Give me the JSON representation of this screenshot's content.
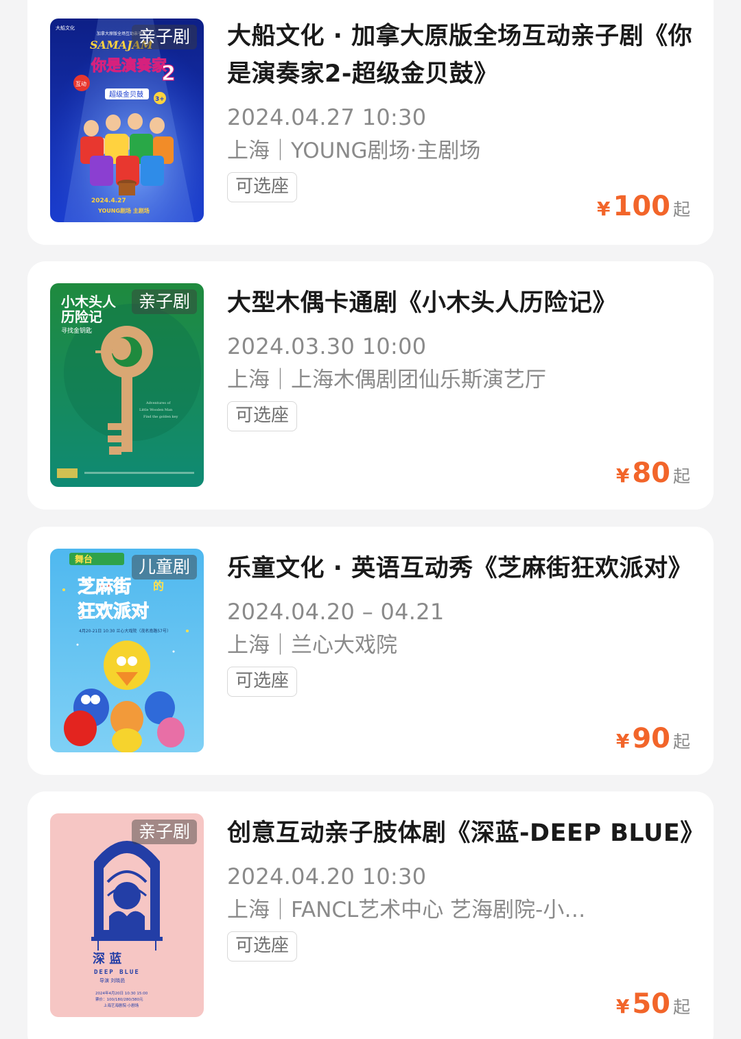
{
  "shows": [
    {
      "category_tag": "亲子剧",
      "title": "大船文化 · 加拿大原版全场互动亲子剧《你是演奏家2-超级金贝鼓》",
      "date": "2024.04.27 10:30",
      "venue": "上海｜YOUNG剧场·主剧场",
      "seat_badge": "可选座",
      "price_currency": "¥",
      "price_value": "100",
      "price_suffix": "起",
      "poster": {
        "corner_brand": "大船文化",
        "top_text": "加拿大原版全场互动亲子剧",
        "brand_word": "SAMAJAM",
        "title_text": "你是演奏家",
        "title_number": "2",
        "subtitle_text": "超级金贝鼓",
        "badge_text": "互动",
        "age_text": "3+",
        "date_text": "2024.4.27",
        "venue_text": "YOUNG剧场 主剧场",
        "bg_top": "#0d1f86",
        "bg_bottom": "#1a3dcf",
        "spot_color": "#7fb3ff"
      }
    },
    {
      "category_tag": "亲子剧",
      "title": "大型木偶卡通剧《小木头人历险记》",
      "date": "2024.03.30 10:00",
      "venue": "上海｜上海木偶剧团仙乐斯演艺厅",
      "seat_badge": "可选座",
      "price_currency": "¥",
      "price_value": "80",
      "price_suffix": "起",
      "poster": {
        "title_line1": "小木头人",
        "title_line2": "历险记",
        "subtitle_text": "寻找金钥匙",
        "english_line1": "Adventures of",
        "english_line2": "Little Wooden Man",
        "english_line3": "Find the golden key",
        "bg_top": "#1f8a3e",
        "bg_bottom": "#0f8a74",
        "key_color": "#d9a773"
      }
    },
    {
      "category_tag": "儿童剧",
      "title": "乐童文化 · 英语互动秀《芝麻街狂欢派对》",
      "date": "2024.04.20 – 04.21",
      "venue": "上海｜兰心大戏院",
      "seat_badge": "可选座",
      "price_currency": "¥",
      "price_value": "90",
      "price_suffix": "起",
      "poster": {
        "top_text": "舞台",
        "title_line1": "芝麻街",
        "title_line2": "狂欢派对",
        "title_particle": "的",
        "info_text": "4月20-21日 10:30 兰心大戏院（茂名南路57号）",
        "bg_top": "#4fb8ef",
        "bg_bottom": "#7fd0f5",
        "title_color": "#e8372f"
      }
    },
    {
      "category_tag": "亲子剧",
      "title": "创意互动亲子肢体剧《深蓝-DEEP BLUE》",
      "date": "2024.04.20 10:30",
      "venue": "上海｜FANCL艺术中心 艺海剧院-小…",
      "seat_badge": "可选座",
      "price_currency": "¥",
      "price_value": "50",
      "price_suffix": "起",
      "poster": {
        "title_text": "深 蓝",
        "english_text": "DEEP BLUE",
        "credit_text": "导演 刘晓邑",
        "date_text": "2024年4月20日 10:30 15:00",
        "price_text": "票价：100/180/280/380元",
        "venue_text": "上海艺海剧院·小剧场",
        "bg_color": "#f6c6c4",
        "ink_color": "#233ea6"
      }
    }
  ]
}
